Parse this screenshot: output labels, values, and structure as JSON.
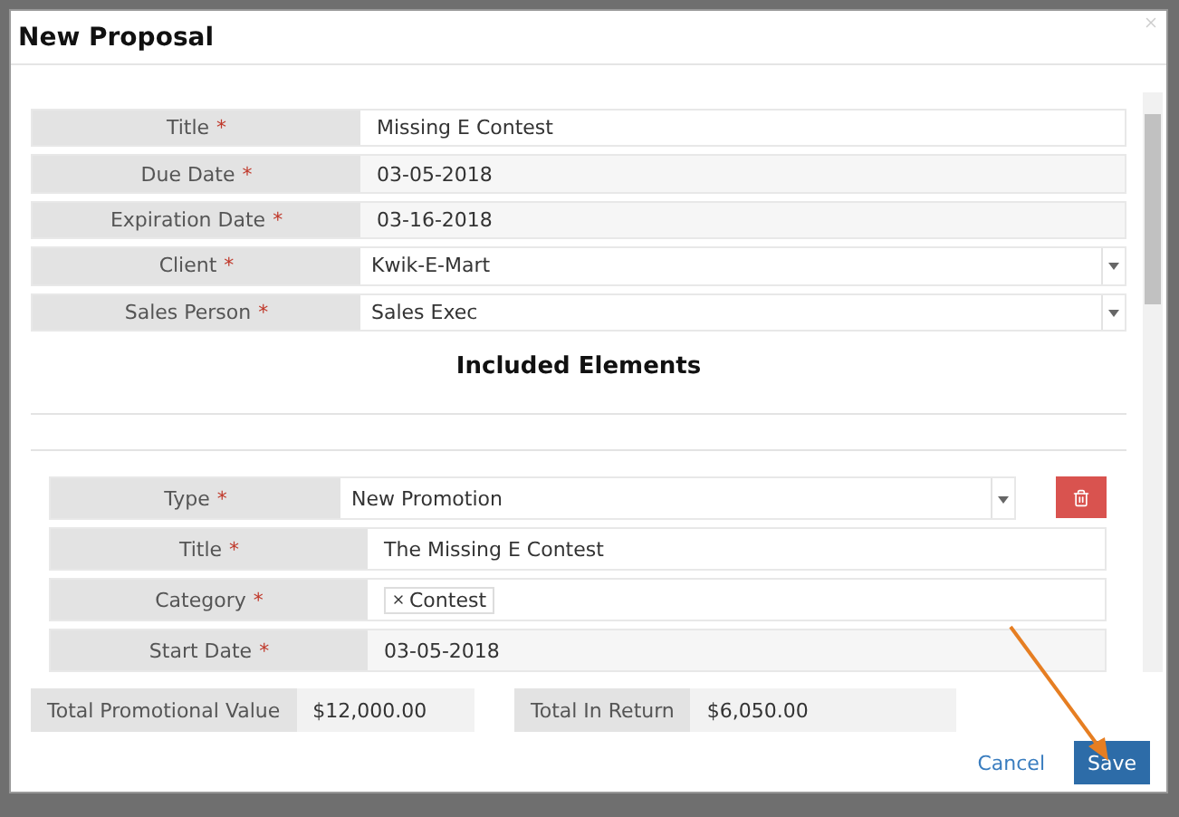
{
  "modal": {
    "title": "New Proposal",
    "required_mark": "*",
    "fields": [
      {
        "label": "Title",
        "required": true,
        "kind": "text",
        "value": "Missing E Contest"
      },
      {
        "label": "Due Date",
        "required": true,
        "kind": "date",
        "value": "03-05-2018"
      },
      {
        "label": "Expiration Date",
        "required": true,
        "kind": "date",
        "value": "03-16-2018"
      },
      {
        "label": "Client",
        "required": true,
        "kind": "select",
        "value": "Kwik-E-Mart"
      },
      {
        "label": "Sales Person",
        "required": true,
        "kind": "select",
        "value": "Sales Exec"
      }
    ],
    "section_title": "Included Elements",
    "element_fields": [
      {
        "label": "Type",
        "required": true,
        "kind": "select",
        "value": "New Promotion"
      },
      {
        "label": "Title",
        "required": true,
        "kind": "text",
        "value": "The Missing E Contest"
      },
      {
        "label": "Category",
        "required": true,
        "kind": "tags",
        "tags": [
          "Contest"
        ]
      },
      {
        "label": "Start Date",
        "required": true,
        "kind": "date",
        "value": "03-05-2018"
      }
    ],
    "totals": [
      {
        "label": "Total Promotional Value",
        "value": "$12,000.00"
      },
      {
        "label": "Total In Return",
        "value": "$6,050.00"
      }
    ],
    "cancel": "Cancel",
    "save": "Save"
  }
}
